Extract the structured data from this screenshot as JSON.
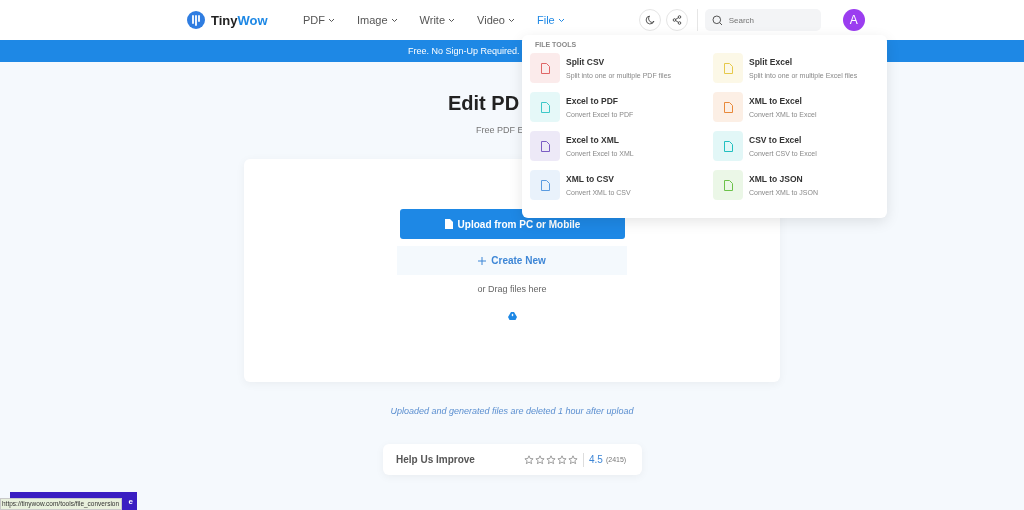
{
  "header": {
    "logo": {
      "part1": "Tiny",
      "part2": "Wow"
    },
    "nav": [
      {
        "label": "PDF",
        "selected": false
      },
      {
        "label": "Image",
        "selected": false
      },
      {
        "label": "Write",
        "selected": false
      },
      {
        "label": "Video",
        "selected": false
      },
      {
        "label": "File",
        "selected": true
      }
    ],
    "search": {
      "placeholder": "Search"
    },
    "avatar": "A"
  },
  "banner": "Free. No Sign-Up Required.",
  "file_menu": {
    "heading": "FILE TOOLS",
    "items": [
      {
        "title": "Split CSV",
        "description": "Split into one or multiple PDF files",
        "color": "#e06666"
      },
      {
        "title": "Split Excel",
        "description": "Split into one or multiple Excel files",
        "color": "#e6c94a"
      },
      {
        "title": "Excel to PDF",
        "description": "Convert Excel to PDF",
        "color": "#3cc8c8"
      },
      {
        "title": "XML to Excel",
        "description": "Convert XML to Excel",
        "color": "#e8893a"
      },
      {
        "title": "Excel to XML",
        "description": "Convert Excel to XML",
        "color": "#7b5cc4"
      },
      {
        "title": "CSV to Excel",
        "description": "Convert CSV to Excel",
        "color": "#22c0c0"
      },
      {
        "title": "XML to CSV",
        "description": "Convert XML to CSV",
        "color": "#5a9be0"
      },
      {
        "title": "XML to JSON",
        "description": "Convert XML to JSON",
        "color": "#6cc24a"
      }
    ]
  },
  "hero": {
    "title": "Edit PD",
    "subtitle": "Free PDF E"
  },
  "upload": {
    "upload_button": "Upload from PC or Mobile",
    "create_button": "Create New",
    "drag_hint": "or Drag files here"
  },
  "note": "Uploaded and generated files are deleted 1 hour after upload",
  "rating": {
    "label": "Help Us Improve",
    "stars": 0,
    "score": "4.5",
    "count": "(2415)"
  },
  "corner_button": "e",
  "status_url": "https://tinywow.com/tools/file_conversion"
}
